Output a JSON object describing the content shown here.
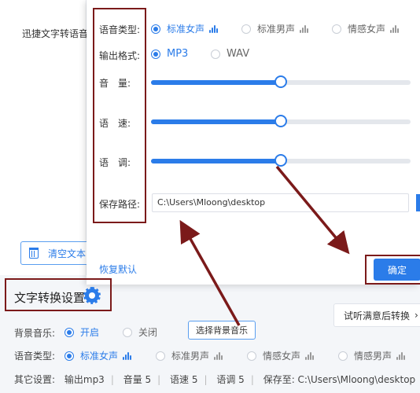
{
  "left_panel": {
    "preview_text": "迅捷文字转语音",
    "clear_label": "清空文本"
  },
  "dialog": {
    "voice_type_label": "语音类型:",
    "voice_options": [
      "标准女声",
      "标准男声",
      "情感女声"
    ],
    "voice_selected": "标准女声",
    "format_label": "输出格式:",
    "format_options": [
      "MP3",
      "WAV"
    ],
    "format_selected": "MP3",
    "volume_label": "音　量:",
    "volume_value": 0.5,
    "speed_label": "语　速:",
    "speed_value": 0.5,
    "pitch_label": "语　调:",
    "pitch_value": 0.5,
    "path_label": "保存路径:",
    "path_value": "C:\\Users\\Mloong\\desktop",
    "reset_label": "恢复默认",
    "confirm_label": "确定"
  },
  "settings": {
    "title": "文字转换设置",
    "try_label": "试听满意后转换",
    "bgm_label": "背景音乐:",
    "bgm_options": [
      "开启",
      "关闭"
    ],
    "bgm_selected": "开启",
    "bgm_button": "选择背景音乐",
    "voice_type_label": "语音类型:",
    "voice_options": [
      "标准女声",
      "标准男声",
      "情感女声",
      "情感男声"
    ],
    "voice_selected": "标准女声",
    "other_label": "其它设置:",
    "other_items": [
      "输出mp3",
      "音量 5",
      "语速 5",
      "语调 5",
      "保存至: C:\\Users\\Mloong\\desktop"
    ]
  },
  "colors": {
    "accent": "#2b7ce9",
    "annotation": "#7b1a1a"
  },
  "icons": [
    "trash-icon",
    "speaker-icon",
    "gear-icon",
    "chevron-right-icon"
  ]
}
